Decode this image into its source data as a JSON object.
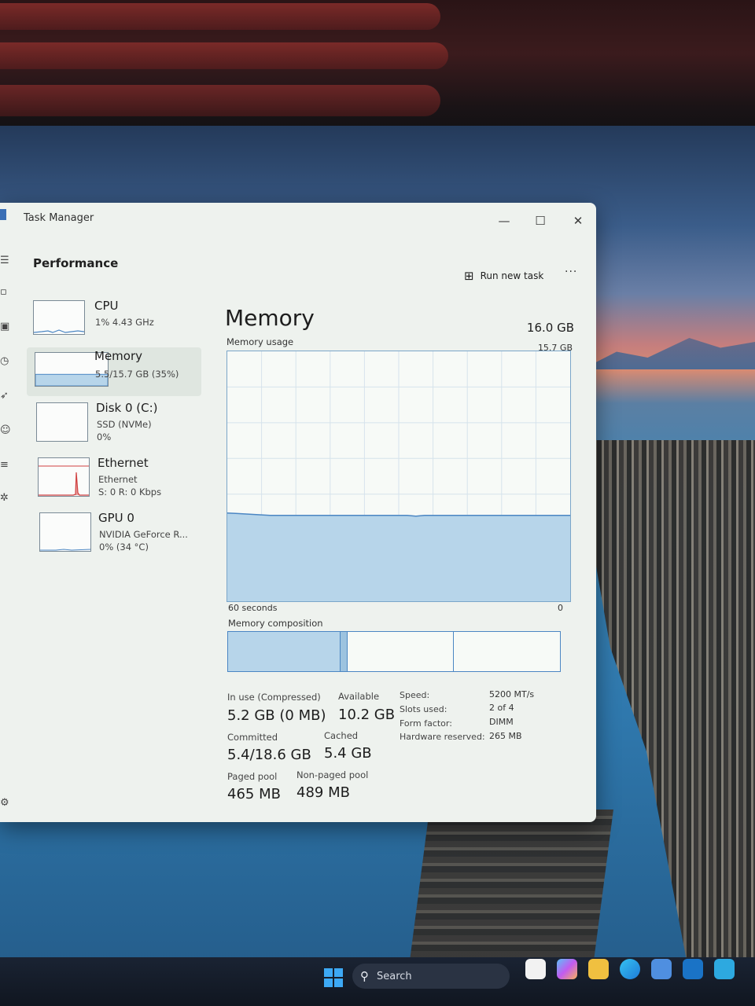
{
  "window": {
    "title": "Task Manager"
  },
  "controls": {
    "minimize": "—",
    "maximize": "☐",
    "close": "✕"
  },
  "page": {
    "header": "Performance",
    "run_new_task": "Run new task",
    "more": "···"
  },
  "sidebar": {
    "items": [
      {
        "name": "CPU",
        "line1": "1% 4.43 GHz",
        "line2": ""
      },
      {
        "name": "Memory",
        "line1": "5.5/15.7 GB (35%)",
        "line2": ""
      },
      {
        "name": "Disk 0 (C:)",
        "line1": "SSD (NVMe)",
        "line2": "0%"
      },
      {
        "name": "Ethernet",
        "line1": "Ethernet",
        "line2": "S: 0 R: 0 Kbps"
      },
      {
        "name": "GPU 0",
        "line1": "NVIDIA GeForce R...",
        "line2": "0% (34 °C)"
      }
    ]
  },
  "memory": {
    "title": "Memory",
    "total": "16.0 GB",
    "usage_label": "Memory usage",
    "max_label": "15.7 GB",
    "time_label": "60 seconds",
    "zero_label": "0",
    "composition_label": "Memory composition",
    "usage_fraction": 0.35,
    "composition": {
      "in_use": 0.34,
      "modified": 0.02,
      "standby": 0.32,
      "free": 0.32
    },
    "stats": {
      "in_use_label": "In use (Compressed)",
      "in_use_value": "5.2 GB (0 MB)",
      "available_label": "Available",
      "available_value": "10.2 GB",
      "committed_label": "Committed",
      "committed_value": "5.4/18.6 GB",
      "cached_label": "Cached",
      "cached_value": "5.4 GB",
      "paged_label": "Paged pool",
      "paged_value": "465 MB",
      "nonpaged_label": "Non-paged pool",
      "nonpaged_value": "489 MB"
    },
    "specs": {
      "speed_label": "Speed:",
      "speed_value": "5200 MT/s",
      "slots_label": "Slots used:",
      "slots_value": "2 of 4",
      "form_label": "Form factor:",
      "form_value": "DIMM",
      "hw_label": "Hardware reserved:",
      "hw_value": "265 MB"
    }
  },
  "taskbar": {
    "search_placeholder": "Search"
  },
  "colors": {
    "accent": "#4b86c3",
    "fill": "#b7d5ea",
    "window_bg": "#eef2ee",
    "ethernet_line": "#d04040"
  }
}
